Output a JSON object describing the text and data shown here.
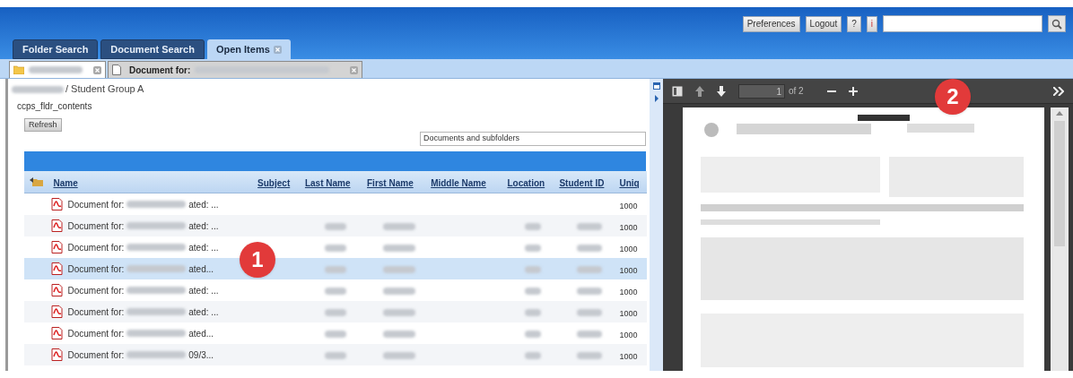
{
  "top_buttons": [
    "Preferences",
    "Logout",
    "?",
    "i"
  ],
  "tabs": [
    {
      "label": "Folder Search",
      "selected": false
    },
    {
      "label": "Document Search",
      "selected": false
    },
    {
      "label": "Open Items",
      "selected": true
    }
  ],
  "open_items": [
    {
      "kind": "folder",
      "selected": true
    },
    {
      "kind": "document",
      "label": "Document for:",
      "selected": false
    }
  ],
  "breadcrumb": "/ Student Group A",
  "folder_name": "ccps_fldr_contents",
  "refresh_button": "Refresh",
  "filter": {
    "value": "Documents and subfolders"
  },
  "table": {
    "columns": [
      "Name",
      "Subject",
      "Last Name",
      "First Name",
      "Middle Name",
      "Location",
      "Student ID",
      "Uniq"
    ],
    "rows": [
      {
        "name": "Document for:",
        "suffix": "ated: ...",
        "unique": "1000",
        "details_shown": false,
        "selected": false
      },
      {
        "name": "Document for:",
        "suffix": "ated: ...",
        "unique": "1000",
        "details_shown": true,
        "selected": false
      },
      {
        "name": "Document for:",
        "suffix": "ated: ...",
        "unique": "1000",
        "details_shown": true,
        "selected": false
      },
      {
        "name": "Document for:",
        "suffix": "ated...",
        "unique": "1000",
        "details_shown": true,
        "selected": true
      },
      {
        "name": "Document for:",
        "suffix": "ated: ...",
        "unique": "1000",
        "details_shown": true,
        "selected": false
      },
      {
        "name": "Document for:",
        "suffix": "ated: ...",
        "unique": "1000",
        "details_shown": true,
        "selected": false
      },
      {
        "name": "Document for:",
        "suffix": "ated...",
        "unique": "1000",
        "details_shown": true,
        "selected": false
      },
      {
        "name": "Document for:",
        "suffix": "09/3...",
        "unique": "1000",
        "details_shown": true,
        "selected": false
      }
    ]
  },
  "viewer": {
    "page": "1",
    "page_count": "of 2"
  },
  "callouts": [
    "1",
    "2"
  ]
}
